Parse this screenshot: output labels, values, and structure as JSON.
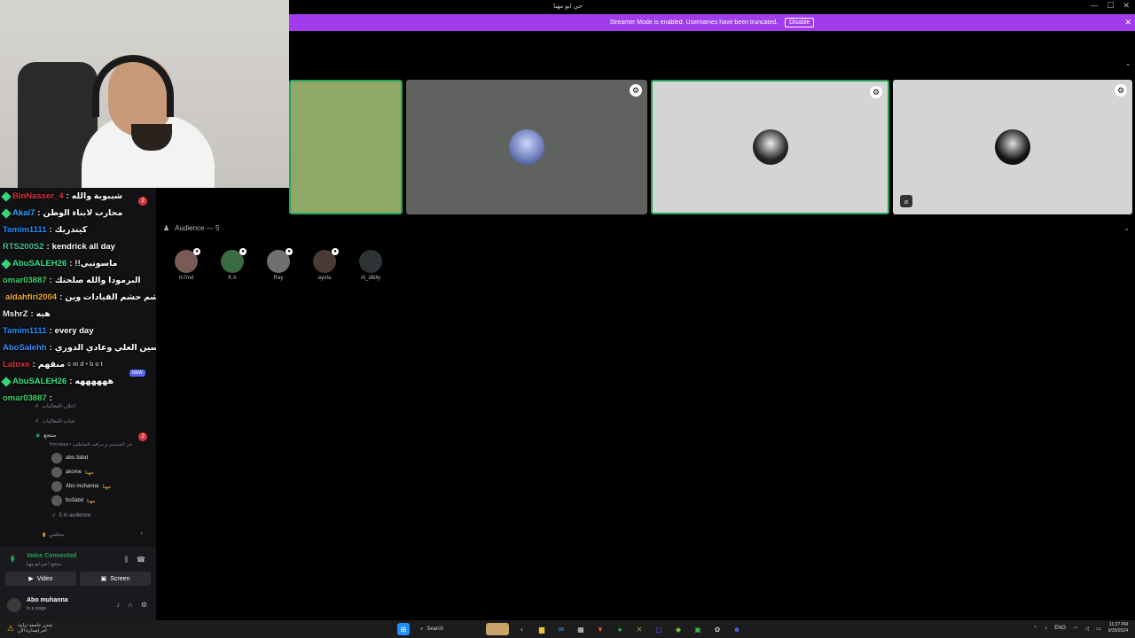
{
  "window": {
    "title": "حي ابو مهنا",
    "controls": [
      "—",
      "☐",
      "✕"
    ]
  },
  "banner": {
    "text": "Streamer Mode is enabled. Usernames have been truncated.",
    "disable_label": "Disable",
    "close": "✕"
  },
  "audience": {
    "label": "Audience — 5",
    "members": [
      "m7md",
      "K A",
      "Ray",
      "ayota",
      "Al_diblly"
    ]
  },
  "chat": {
    "messages": [
      {
        "user": "BinNasser_4",
        "text": "شيبوبة والله",
        "color": "#e0323c",
        "diamond": "#37d67a"
      },
      {
        "user": "Akai7",
        "text": "محارب لابناء الوطن",
        "color": "#2fa8ff",
        "diamond": "#37d67a"
      },
      {
        "user": "Tamim1111",
        "text": "كيندريك",
        "color": "#1e90ff",
        "diamond": ""
      },
      {
        "user": "RTS200S2",
        "text": "kendrick all day",
        "color": "#49c18e",
        "diamond": ""
      },
      {
        "user": "AbuSALEH26",
        "text": "!!ماسوتيي",
        "color": "#38e38a",
        "diamond": "#37d67a"
      },
      {
        "user": "omar03887",
        "text": "البرمودا والله صلحتك",
        "color": "#3fd06a",
        "diamond": ""
      },
      {
        "user": "aldahfiri2004",
        "text": "حشم حشم القيادات وين",
        "color": "#f0a83c",
        "diamond": "#2fa8ff"
      },
      {
        "user": "MshrZ",
        "text": "هيه",
        "color": "#e8e8e8",
        "diamond": ""
      },
      {
        "user": "Tamim1111",
        "text": "every day",
        "color": "#1e90ff",
        "diamond": ""
      },
      {
        "user": "AboSalehh",
        "text": "غير حسين العلي وعادي الدوري",
        "color": "#3c8dff",
        "diamond": ""
      },
      {
        "user": "Latoxe",
        "text": "منقهم",
        "color": "#e0323c",
        "diamond": ""
      },
      {
        "user": "AbuSALEH26",
        "text": "ههههههه",
        "color": "#38e38a",
        "diamond": "#37d67a"
      },
      {
        "user": "omar03887",
        "text": "",
        "color": "#3fd06a",
        "diamond": ""
      }
    ],
    "new_badge": "NEW",
    "overlay_text": "cmd•bot"
  },
  "channels": {
    "unread_count_1": "2",
    "unread_count_2": "2",
    "list": [
      "اعلان-الفعاليات",
      "شات-الفعاليات"
    ],
    "stage": {
      "name": "منتجع",
      "topic": "Hot takes • حي الشتيمين و مراقب الشاطئين"
    },
    "participants": [
      {
        "name": "abo.3abd",
        "crown": ""
      },
      {
        "name": "akome",
        "crown": "مهنا"
      },
      {
        "name": "Abo muhanna",
        "crown": "مهنا"
      },
      {
        "name": "bo3abd",
        "crown": "مهنا"
      }
    ],
    "audience_count": "5 in audience",
    "category": "مجلس"
  },
  "voice_panel": {
    "status": "Voice Connected",
    "sub": "منتجع / حي ابو مهنا",
    "video_label": "Video",
    "screen_label": "Screen",
    "user": "Abo muhanna",
    "user_status": "In a stage"
  },
  "taskbar": {
    "weather_line1": "تحذير عاصفة ترابية",
    "weather_line2": "آخر إصدارة الآن",
    "search_label": "Search",
    "lang": "ENG",
    "time": "11:27 PM",
    "date": "9/30/2024"
  },
  "colors": {
    "accent": "#a03ceb",
    "voice_green": "#23a55a",
    "tile_green": "#23a55a",
    "brand": "#5865f2"
  }
}
